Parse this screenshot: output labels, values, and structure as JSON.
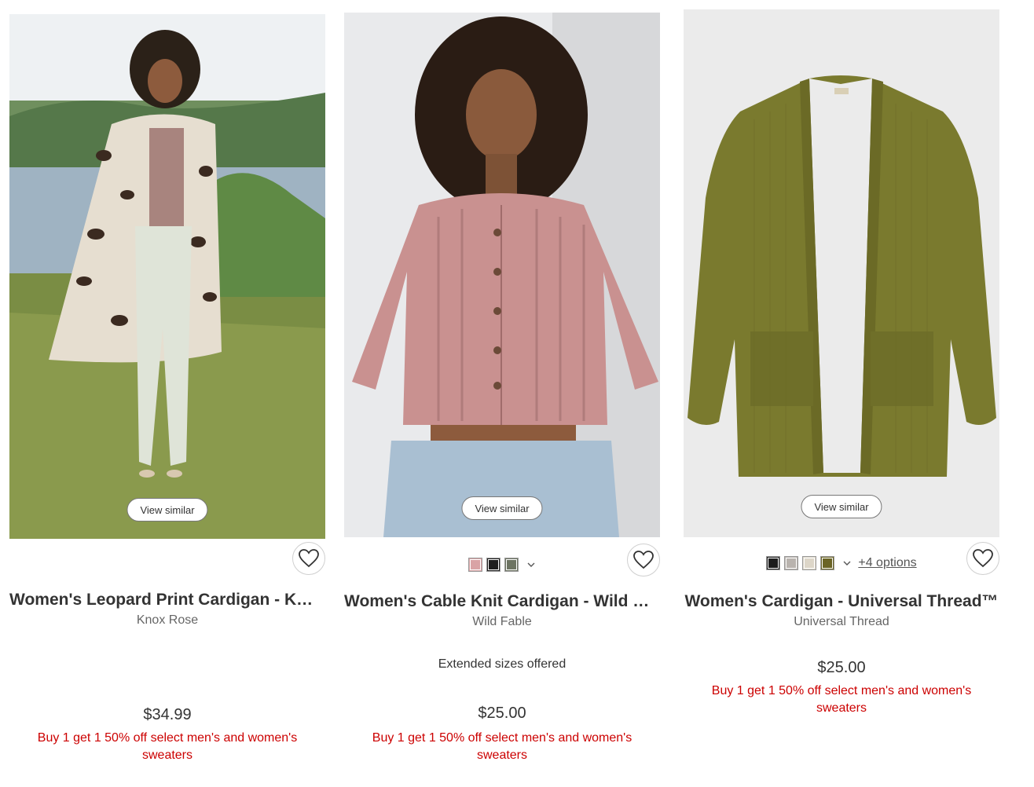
{
  "products": [
    {
      "title": "Women's Leopard Print Cardigan - K…",
      "brand": "Knox Rose",
      "price": "$34.99",
      "promo": "Buy 1 get 1 50% off select men's and women's sweaters",
      "view_similar": "View similar"
    },
    {
      "title": "Women's Cable Knit Cardigan - Wild …",
      "brand": "Wild Fable",
      "extended_sizes": "Extended sizes offered",
      "price": "$25.00",
      "promo": "Buy 1 get 1 50% off select men's and women's sweaters",
      "view_similar": "View similar",
      "swatch_colors": [
        "#d9a3a5",
        "#1f1f1f",
        "#6d7462"
      ]
    },
    {
      "title": "Women's Cardigan - Universal Thread™",
      "brand": "Universal Thread",
      "price": "$25.00",
      "promo": "Buy 1 get 1 50% off select men's and women's sweaters",
      "view_similar": "View similar",
      "swatch_colors": [
        "#1c1c1c",
        "#b9b3ae",
        "#ddd6c8",
        "#6b6425"
      ],
      "more_options": "+4 options"
    }
  ],
  "icons": {
    "favorite": "heart-outline-icon",
    "expand": "chevron-down-icon"
  },
  "colors": {
    "promo": "#cc0000",
    "text": "#333333",
    "brand": "#666666"
  }
}
